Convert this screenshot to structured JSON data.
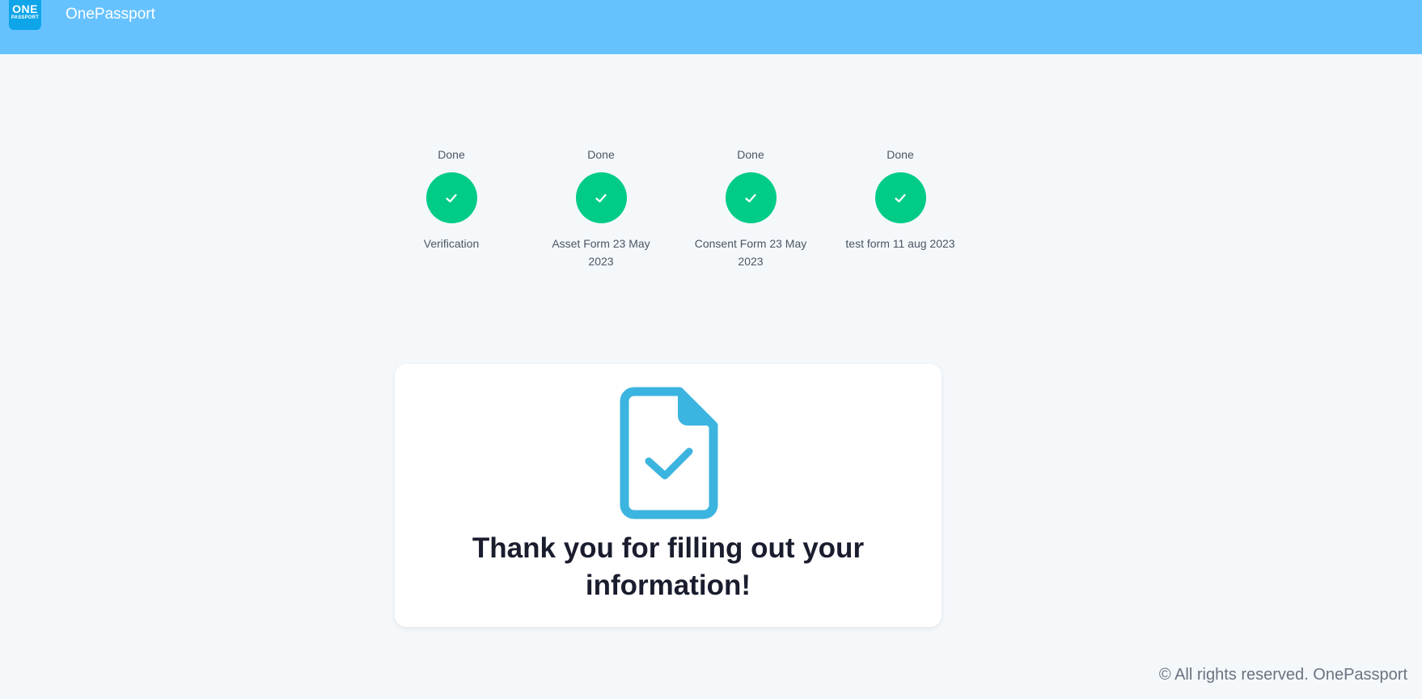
{
  "header": {
    "logo_top": "ONE",
    "logo_bottom": "PASSPORT",
    "title": "OnePassport",
    "background_color": "#66c2ff"
  },
  "steps": [
    {
      "status": "Done",
      "label": "Verification",
      "icon": "check-icon"
    },
    {
      "status": "Done",
      "label": "Asset Form 23 May 2023",
      "icon": "check-icon"
    },
    {
      "status": "Done",
      "label": "Consent Form 23 May 2023",
      "icon": "check-icon"
    },
    {
      "status": "Done",
      "label": "test form 11 aug 2023",
      "icon": "check-icon"
    }
  ],
  "step_color": "#00cc88",
  "card": {
    "icon": "document-check-icon",
    "icon_color": "#3cb4e0",
    "message_line1": "Thank you for filling out your",
    "message_line2": "information!"
  },
  "footer": {
    "text": "© All rights reserved. OnePassport"
  }
}
